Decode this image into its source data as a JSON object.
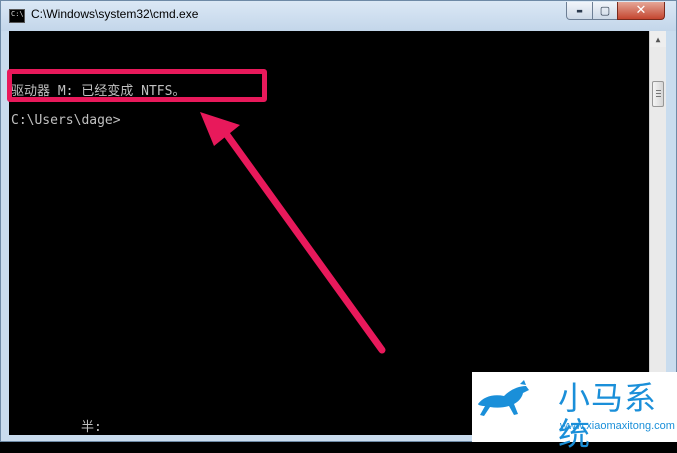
{
  "window": {
    "title": "C:\\Windows\\system32\\cmd.exe",
    "icon_text": "C:\\",
    "minimize_glyph": "▬",
    "maximize_glyph": "▢",
    "close_glyph": "✕"
  },
  "console": {
    "lines": [
      "驱动器 M: 已经变成 NTFS。",
      "C:\\Users\\dage>",
      "半:"
    ]
  },
  "logo": {
    "name": "小马系统",
    "url": "www.xiaomaxitong.com"
  },
  "colors": {
    "highlight": "#e8195b",
    "console_bg": "#000000",
    "console_text": "#c0c0c0",
    "logo_blue": "#1a8fd9"
  }
}
